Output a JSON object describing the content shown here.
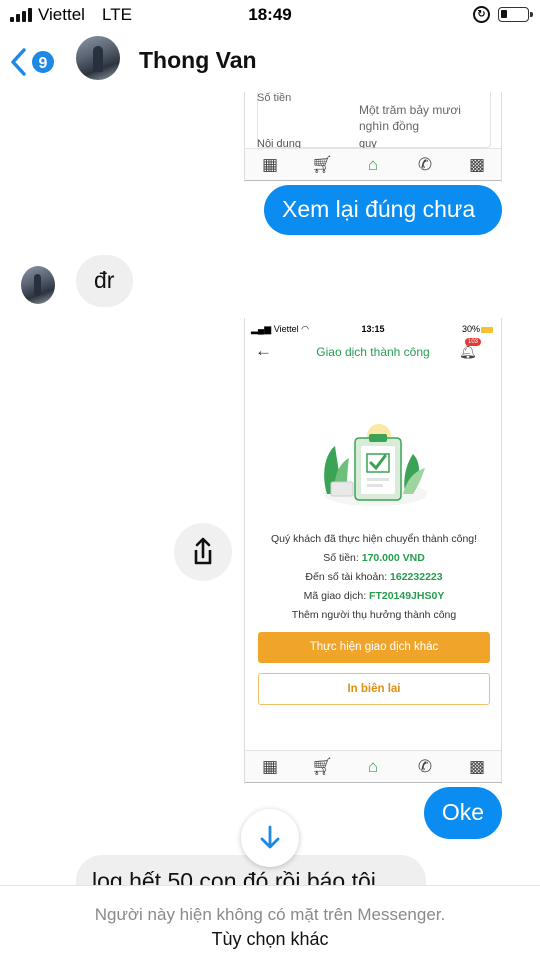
{
  "status_bar": {
    "carrier": "Viettel",
    "network": "LTE",
    "time": "18:49"
  },
  "header": {
    "back_count": "9",
    "contact_name": "Thong Van"
  },
  "messages": {
    "m1": "Xem lại đúng chưa",
    "m2": "đr",
    "m3": "Oke",
    "m4_partial": "log hết 50 con đó rồi báo tôi"
  },
  "shot1": {
    "amount_label": "Số tiền",
    "amount_words": "Một trăm bảy mươi nghìn đồng",
    "content_label": "Nội dung",
    "content_value": "quy"
  },
  "shot2": {
    "carrier": "Viettel",
    "time": "13:15",
    "battery": "30%",
    "title": "Giao dịch thành công",
    "badge": "103",
    "line1": "Quý khách đã thực hiện chuyển thành công!",
    "amount_label": "Số tiền: ",
    "amount_value": "170.000 VND",
    "account_label": "Đến số tài khoản: ",
    "account_value": "162232223",
    "txn_label": "Mã giao dịch: ",
    "txn_value": "FT20149JHS0Y",
    "line5": "Thêm người thụ hưởng thành công",
    "btn_primary": "Thực hiện giao dịch khác",
    "btn_secondary": "In biên lai"
  },
  "footer": {
    "note": "Người này hiện không có mặt trên Messenger.",
    "link": "Tùy chọn khác"
  },
  "icons": {
    "back": "chevron-left-icon",
    "share": "share-icon",
    "scroll": "arrow-down-icon"
  },
  "colors": {
    "messenger_blue": "#0a8cf0",
    "bank_green": "#249d4f",
    "bank_orange": "#f0a52a"
  }
}
